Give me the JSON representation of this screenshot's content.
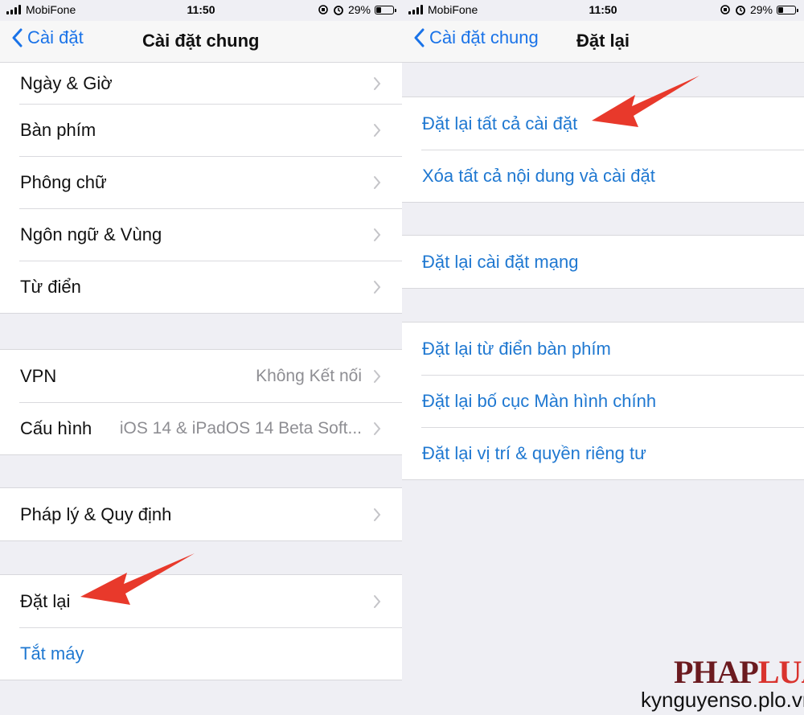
{
  "status": {
    "carrier": "MobiFone",
    "time": "11:50",
    "battery": "29%",
    "battery_level": 0.29
  },
  "left": {
    "back_label": "Cài đặt",
    "title": "Cài đặt chung",
    "rows": {
      "date_time": "Ngày & Giờ",
      "keyboard": "Bàn phím",
      "font": "Phông chữ",
      "language_region": "Ngôn ngữ & Vùng",
      "dictionary": "Từ điển",
      "vpn": "VPN",
      "vpn_value": "Không Kết nối",
      "profile": "Cấu hình",
      "profile_value": "iOS 14 & iPadOS 14 Beta Soft...",
      "legal": "Pháp lý & Quy định",
      "reset": "Đặt lại",
      "shutdown": "Tắt máy"
    }
  },
  "right": {
    "back_label": "Cài đặt chung",
    "title": "Đặt lại",
    "rows": {
      "reset_all": "Đặt lại tất cả cài đặt",
      "erase_all": "Xóa tất cả nội dung và cài đặt",
      "reset_network": "Đặt lại cài đặt mạng",
      "reset_keyboard": "Đặt lại từ điển bàn phím",
      "reset_home": "Đặt lại bố cục Màn hình chính",
      "reset_location": "Đặt lại vị trí & quyền riêng tư"
    }
  },
  "watermark": {
    "logo_part1": "PHAP",
    "logo_part2": "LUAT",
    "site": "kynguyenso.plo.vn"
  },
  "colors": {
    "ios_blue": "#1f78d1",
    "annotation_arrow": "#e8392b",
    "background": "#efeff4"
  },
  "icons": [
    "signal-icon",
    "alarm-icon",
    "battery-icon",
    "chevron-left-icon",
    "chevron-right-icon",
    "arrow-annotation-icon"
  ]
}
